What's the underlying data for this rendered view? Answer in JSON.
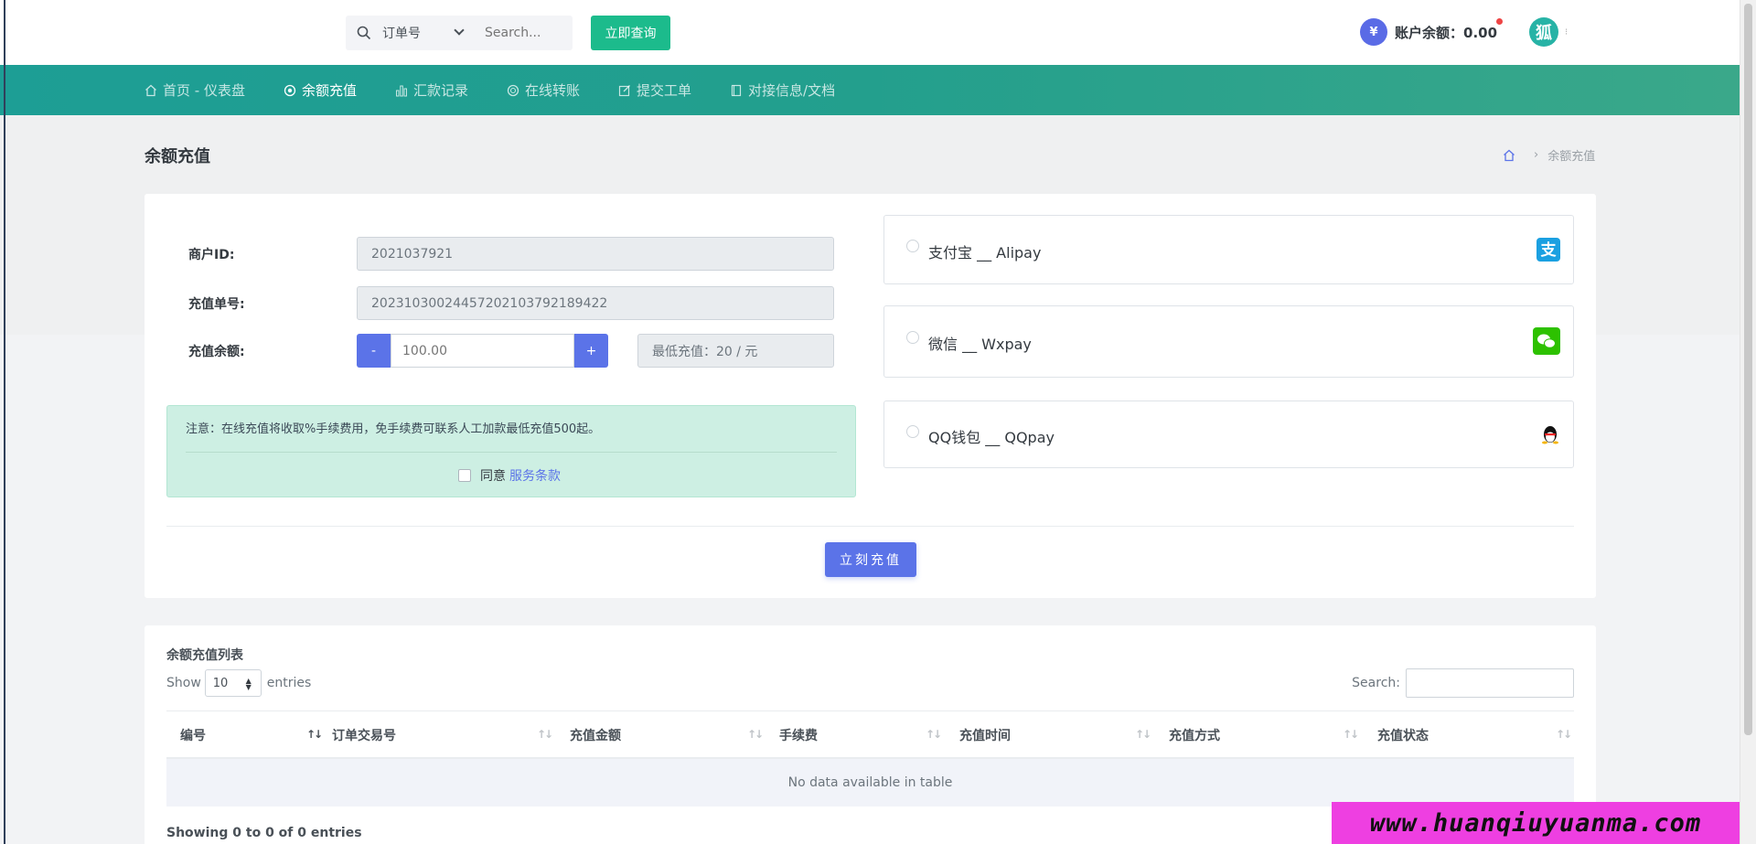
{
  "topbar": {
    "search_select_value": "订单号",
    "search_placeholder": "Search...",
    "search_button": "立即查询",
    "balance_icon": "¥",
    "balance_label": "账户余额：0.00",
    "avatar_text": "狐"
  },
  "nav": {
    "items": [
      {
        "label": "首页 - 仪表盘",
        "icon": "home-icon"
      },
      {
        "label": "余额充值",
        "icon": "target-icon"
      },
      {
        "label": "汇款记录",
        "icon": "bar-chart-icon"
      },
      {
        "label": "在线转账",
        "icon": "globe-icon"
      },
      {
        "label": "提交工单",
        "icon": "edit-icon"
      },
      {
        "label": "对接信息/文档",
        "icon": "book-icon"
      }
    ]
  },
  "page": {
    "title": "余额充值",
    "breadcrumb_current": "余额充值"
  },
  "form": {
    "merchant_label": "商户ID:",
    "merchant_value": "2021037921",
    "order_label": "充值单号:",
    "order_value": "20231030024457202103792189422",
    "amount_label": "充值余额:",
    "minus": "-",
    "plus": "+",
    "amount_placeholder": "100.00",
    "min_text": "最低充值：20 / 元",
    "notice": "注意：在线充值将收取%手续费用，免手续费可联系人工加款最低充值500起。",
    "agree_text": "同意",
    "terms_link": "服务条款",
    "submit": "立刻充值"
  },
  "payment": {
    "options": [
      {
        "name": "支付宝 __ Alipay",
        "icon": "alipay-icon",
        "color": "#1ba0e1"
      },
      {
        "name": "微信 __ Wxpay",
        "icon": "wechat-icon",
        "color": "#2dc100"
      },
      {
        "name": "QQ钱包 __ QQpay",
        "icon": "qq-icon",
        "color": "#111111"
      }
    ]
  },
  "table": {
    "title": "余额充值列表",
    "show": "Show",
    "length_value": "10",
    "entries": "entries",
    "search_label": "Search:",
    "columns": [
      "编号",
      "订单交易号",
      "充值金额",
      "手续费",
      "充值时间",
      "充值方式",
      "充值状态"
    ],
    "empty": "No data available in table",
    "info": "Showing 0 to 0 of 0 entries"
  },
  "watermark": "www.huanqiuyuanma.com",
  "colors": {
    "primary": "#5b73e8",
    "success": "#1cbb8c",
    "nav_start": "#1d9e95",
    "nav_end": "#3aa88a"
  }
}
